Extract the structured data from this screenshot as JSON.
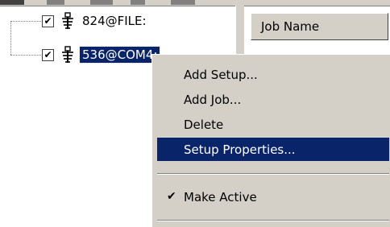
{
  "tree": {
    "nodes": [
      {
        "label": "824@FILE:",
        "checked": true,
        "icon": "device-icon",
        "selected": false
      },
      {
        "label": "536@COM4:",
        "checked": true,
        "icon": "device-icon",
        "selected": true
      }
    ]
  },
  "list": {
    "columns": [
      "Job Name"
    ]
  },
  "context_menu": {
    "items": [
      {
        "label": "Add Setup..."
      },
      {
        "label": "Add Job..."
      },
      {
        "label": "Delete"
      },
      {
        "label": "Setup Properties...",
        "highlighted": true
      }
    ],
    "check_items": [
      {
        "label": "Make Active",
        "checked": true
      }
    ]
  },
  "glyphs": {
    "check": "✔"
  },
  "colors": {
    "highlight": "#0a246a",
    "face": "#d4d0c8"
  }
}
